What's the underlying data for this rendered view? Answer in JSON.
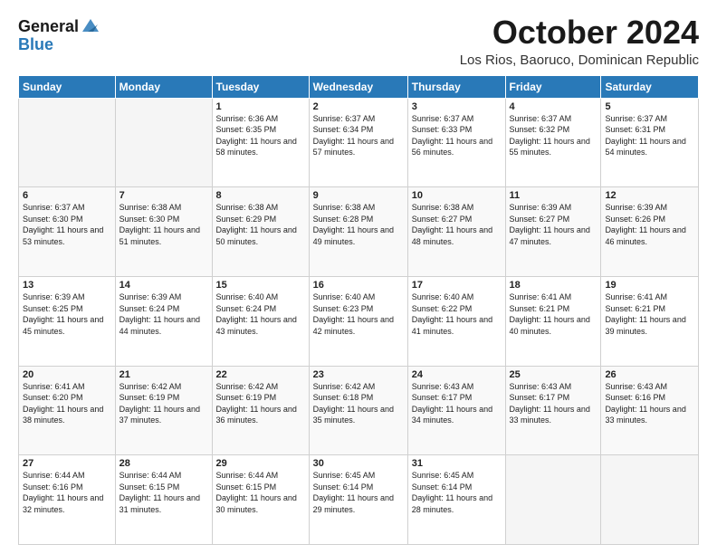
{
  "logo": {
    "line1": "General",
    "line2": "Blue"
  },
  "title": "October 2024",
  "location": "Los Rios, Baoruco, Dominican Republic",
  "days_of_week": [
    "Sunday",
    "Monday",
    "Tuesday",
    "Wednesday",
    "Thursday",
    "Friday",
    "Saturday"
  ],
  "weeks": [
    [
      {
        "day": "",
        "empty": true
      },
      {
        "day": "",
        "empty": true
      },
      {
        "day": "1",
        "sunrise": "6:36 AM",
        "sunset": "6:35 PM",
        "daylight": "11 hours and 58 minutes."
      },
      {
        "day": "2",
        "sunrise": "6:37 AM",
        "sunset": "6:34 PM",
        "daylight": "11 hours and 57 minutes."
      },
      {
        "day": "3",
        "sunrise": "6:37 AM",
        "sunset": "6:33 PM",
        "daylight": "11 hours and 56 minutes."
      },
      {
        "day": "4",
        "sunrise": "6:37 AM",
        "sunset": "6:32 PM",
        "daylight": "11 hours and 55 minutes."
      },
      {
        "day": "5",
        "sunrise": "6:37 AM",
        "sunset": "6:31 PM",
        "daylight": "11 hours and 54 minutes."
      }
    ],
    [
      {
        "day": "6",
        "sunrise": "6:37 AM",
        "sunset": "6:30 PM",
        "daylight": "11 hours and 53 minutes."
      },
      {
        "day": "7",
        "sunrise": "6:38 AM",
        "sunset": "6:30 PM",
        "daylight": "11 hours and 51 minutes."
      },
      {
        "day": "8",
        "sunrise": "6:38 AM",
        "sunset": "6:29 PM",
        "daylight": "11 hours and 50 minutes."
      },
      {
        "day": "9",
        "sunrise": "6:38 AM",
        "sunset": "6:28 PM",
        "daylight": "11 hours and 49 minutes."
      },
      {
        "day": "10",
        "sunrise": "6:38 AM",
        "sunset": "6:27 PM",
        "daylight": "11 hours and 48 minutes."
      },
      {
        "day": "11",
        "sunrise": "6:39 AM",
        "sunset": "6:27 PM",
        "daylight": "11 hours and 47 minutes."
      },
      {
        "day": "12",
        "sunrise": "6:39 AM",
        "sunset": "6:26 PM",
        "daylight": "11 hours and 46 minutes."
      }
    ],
    [
      {
        "day": "13",
        "sunrise": "6:39 AM",
        "sunset": "6:25 PM",
        "daylight": "11 hours and 45 minutes."
      },
      {
        "day": "14",
        "sunrise": "6:39 AM",
        "sunset": "6:24 PM",
        "daylight": "11 hours and 44 minutes."
      },
      {
        "day": "15",
        "sunrise": "6:40 AM",
        "sunset": "6:24 PM",
        "daylight": "11 hours and 43 minutes."
      },
      {
        "day": "16",
        "sunrise": "6:40 AM",
        "sunset": "6:23 PM",
        "daylight": "11 hours and 42 minutes."
      },
      {
        "day": "17",
        "sunrise": "6:40 AM",
        "sunset": "6:22 PM",
        "daylight": "11 hours and 41 minutes."
      },
      {
        "day": "18",
        "sunrise": "6:41 AM",
        "sunset": "6:21 PM",
        "daylight": "11 hours and 40 minutes."
      },
      {
        "day": "19",
        "sunrise": "6:41 AM",
        "sunset": "6:21 PM",
        "daylight": "11 hours and 39 minutes."
      }
    ],
    [
      {
        "day": "20",
        "sunrise": "6:41 AM",
        "sunset": "6:20 PM",
        "daylight": "11 hours and 38 minutes."
      },
      {
        "day": "21",
        "sunrise": "6:42 AM",
        "sunset": "6:19 PM",
        "daylight": "11 hours and 37 minutes."
      },
      {
        "day": "22",
        "sunrise": "6:42 AM",
        "sunset": "6:19 PM",
        "daylight": "11 hours and 36 minutes."
      },
      {
        "day": "23",
        "sunrise": "6:42 AM",
        "sunset": "6:18 PM",
        "daylight": "11 hours and 35 minutes."
      },
      {
        "day": "24",
        "sunrise": "6:43 AM",
        "sunset": "6:17 PM",
        "daylight": "11 hours and 34 minutes."
      },
      {
        "day": "25",
        "sunrise": "6:43 AM",
        "sunset": "6:17 PM",
        "daylight": "11 hours and 33 minutes."
      },
      {
        "day": "26",
        "sunrise": "6:43 AM",
        "sunset": "6:16 PM",
        "daylight": "11 hours and 33 minutes."
      }
    ],
    [
      {
        "day": "27",
        "sunrise": "6:44 AM",
        "sunset": "6:16 PM",
        "daylight": "11 hours and 32 minutes."
      },
      {
        "day": "28",
        "sunrise": "6:44 AM",
        "sunset": "6:15 PM",
        "daylight": "11 hours and 31 minutes."
      },
      {
        "day": "29",
        "sunrise": "6:44 AM",
        "sunset": "6:15 PM",
        "daylight": "11 hours and 30 minutes."
      },
      {
        "day": "30",
        "sunrise": "6:45 AM",
        "sunset": "6:14 PM",
        "daylight": "11 hours and 29 minutes."
      },
      {
        "day": "31",
        "sunrise": "6:45 AM",
        "sunset": "6:14 PM",
        "daylight": "11 hours and 28 minutes."
      },
      {
        "day": "",
        "empty": true
      },
      {
        "day": "",
        "empty": true
      }
    ]
  ],
  "labels": {
    "sunrise": "Sunrise:",
    "sunset": "Sunset:",
    "daylight": "Daylight:"
  }
}
